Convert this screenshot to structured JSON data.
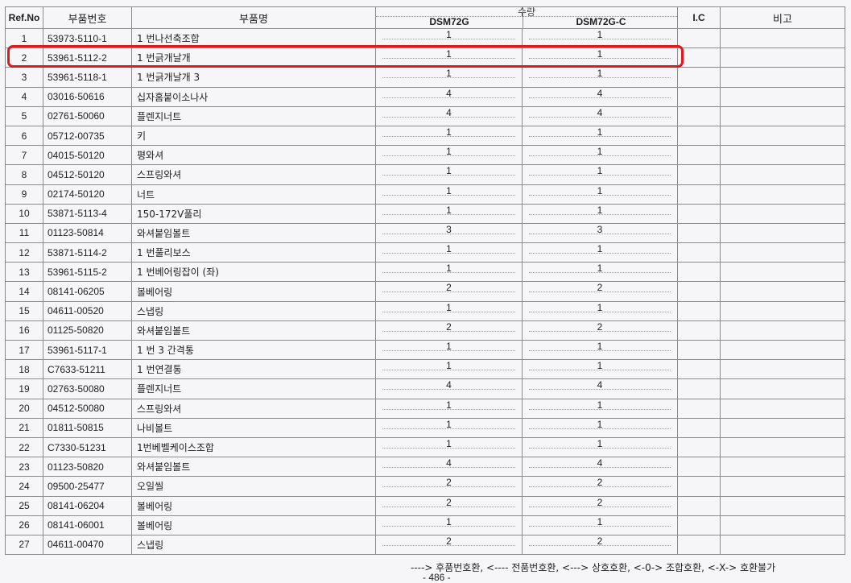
{
  "header": {
    "ref_no": "Ref.No",
    "part_no": "부품번호",
    "part_name": "부품명",
    "quantity": "수량",
    "model_1": "DSM72G",
    "model_2": "DSM72G-C",
    "ic": "I.C",
    "remarks": "비고"
  },
  "rows": [
    {
      "ref": "1",
      "part_no": "53973-5110-1",
      "name": "1 번나선축조합",
      "q1": "1",
      "q2": "1"
    },
    {
      "ref": "2",
      "part_no": "53961-5112-2",
      "name": "1 번긁개날개",
      "q1": "1",
      "q2": "1"
    },
    {
      "ref": "3",
      "part_no": "53961-5118-1",
      "name": "1 번긁개날개 3",
      "q1": "1",
      "q2": "1"
    },
    {
      "ref": "4",
      "part_no": "03016-50616",
      "name": "십자홈붙이소나사",
      "q1": "4",
      "q2": "4"
    },
    {
      "ref": "5",
      "part_no": "02761-50060",
      "name": "플렌지너트",
      "q1": "4",
      "q2": "4"
    },
    {
      "ref": "6",
      "part_no": "05712-00735",
      "name": "키",
      "q1": "1",
      "q2": "1"
    },
    {
      "ref": "7",
      "part_no": "04015-50120",
      "name": "평와셔",
      "q1": "1",
      "q2": "1"
    },
    {
      "ref": "8",
      "part_no": "04512-50120",
      "name": "스프링와셔",
      "q1": "1",
      "q2": "1"
    },
    {
      "ref": "9",
      "part_no": "02174-50120",
      "name": "너트",
      "q1": "1",
      "q2": "1"
    },
    {
      "ref": "10",
      "part_no": "53871-5113-4",
      "name": "150-172V풀리",
      "q1": "1",
      "q2": "1"
    },
    {
      "ref": "11",
      "part_no": "01123-50814",
      "name": "와셔붙임볼트",
      "q1": "3",
      "q2": "3"
    },
    {
      "ref": "12",
      "part_no": "53871-5114-2",
      "name": "1 번풀리보스",
      "q1": "1",
      "q2": "1"
    },
    {
      "ref": "13",
      "part_no": "53961-5115-2",
      "name": "1 번베어링잡이 (좌)",
      "q1": "1",
      "q2": "1"
    },
    {
      "ref": "14",
      "part_no": "08141-06205",
      "name": "볼베어링",
      "q1": "2",
      "q2": "2"
    },
    {
      "ref": "15",
      "part_no": "04611-00520",
      "name": "스냅링",
      "q1": "1",
      "q2": "1"
    },
    {
      "ref": "16",
      "part_no": "01125-50820",
      "name": "와셔붙임볼트",
      "q1": "2",
      "q2": "2"
    },
    {
      "ref": "17",
      "part_no": "53961-5117-1",
      "name": "1 번 3 간격통",
      "q1": "1",
      "q2": "1"
    },
    {
      "ref": "18",
      "part_no": "C7633-51211",
      "name": "1 번연결통",
      "q1": "1",
      "q2": "1"
    },
    {
      "ref": "19",
      "part_no": "02763-50080",
      "name": "플렌지너트",
      "q1": "4",
      "q2": "4"
    },
    {
      "ref": "20",
      "part_no": "04512-50080",
      "name": "스프링와셔",
      "q1": "1",
      "q2": "1"
    },
    {
      "ref": "21",
      "part_no": "01811-50815",
      "name": "나비볼트",
      "q1": "1",
      "q2": "1"
    },
    {
      "ref": "22",
      "part_no": "C7330-51231",
      "name": "1번베벨케이스조합",
      "q1": "1",
      "q2": "1"
    },
    {
      "ref": "23",
      "part_no": "01123-50820",
      "name": "와셔붙임볼트",
      "q1": "4",
      "q2": "4"
    },
    {
      "ref": "24",
      "part_no": "09500-25477",
      "name": "오일씰",
      "q1": "2",
      "q2": "2"
    },
    {
      "ref": "25",
      "part_no": "08141-06204",
      "name": "볼베어링",
      "q1": "2",
      "q2": "2"
    },
    {
      "ref": "26",
      "part_no": "08141-06001",
      "name": "볼베어링",
      "q1": "1",
      "q2": "1"
    },
    {
      "ref": "27",
      "part_no": "04611-00470",
      "name": "스냅링",
      "q1": "2",
      "q2": "2"
    }
  ],
  "legend": "----> 후품번호환, <---- 전품번호환, <---> 상호호환, <-0-> 조합호환, <-X-> 호환불가",
  "page_number": "- 486 -",
  "colors": {
    "highlight": "#e01a1a",
    "grid": "#8c8c8c",
    "paper": "#f6f6f8"
  }
}
